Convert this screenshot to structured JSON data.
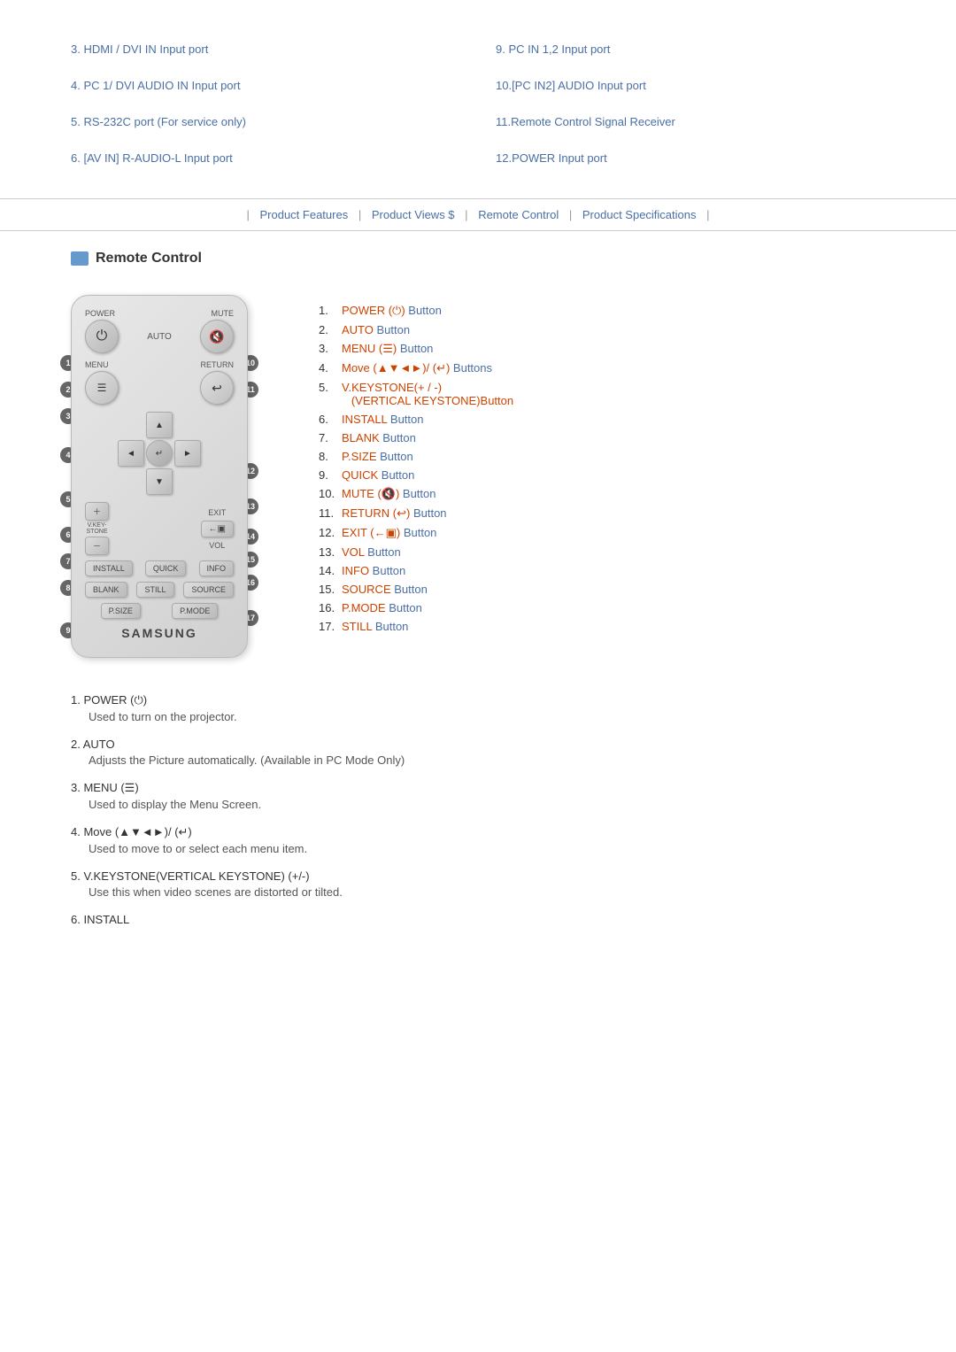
{
  "top_items": [
    {
      "id": "item3",
      "text": "3. HDMI / DVI IN Input port"
    },
    {
      "id": "item9",
      "text": "9. PC IN 1,2 Input port"
    },
    {
      "id": "item4",
      "text": "4. PC 1/ DVI  AUDIO IN Input port"
    },
    {
      "id": "item10",
      "text": "10.[PC IN2]  AUDIO Input port"
    },
    {
      "id": "item5",
      "text": "5. RS-232C port (For service only)"
    },
    {
      "id": "item11",
      "text": "11.Remote Control Signal Receiver"
    },
    {
      "id": "item6",
      "text": "6. [AV IN] R-AUDIO-L Input port"
    },
    {
      "id": "item12",
      "text": "12.POWER Input port"
    }
  ],
  "nav": {
    "pipe": "|",
    "links": [
      "Product Features",
      "Product Views $",
      "Remote Control",
      "Product Specifications"
    ]
  },
  "section": {
    "title": "Remote Control"
  },
  "button_list": [
    {
      "num": "1.",
      "text": "POWER (",
      "icon": "⏻",
      "suffix": ") Button"
    },
    {
      "num": "2.",
      "text": "AUTO Button",
      "icon": "",
      "suffix": ""
    },
    {
      "num": "3.",
      "text": "MENU (",
      "icon": "☰",
      "suffix": ") Button"
    },
    {
      "num": "4.",
      "text": "Move (▲▼◄►)/ (",
      "icon": "↵",
      "suffix": ") Buttons"
    },
    {
      "num": "5.",
      "text": "V.KEYSTONE(+ / -)\n(VERTICAL KEYSTONE)Button",
      "icon": "",
      "suffix": ""
    },
    {
      "num": "6.",
      "text": "INSTALL Button",
      "icon": "",
      "suffix": ""
    },
    {
      "num": "7.",
      "text": "BLANK Button",
      "icon": "",
      "suffix": ""
    },
    {
      "num": "8.",
      "text": "P.SIZE Button",
      "icon": "",
      "suffix": ""
    },
    {
      "num": "9.",
      "text": "QUICK Button",
      "icon": "",
      "suffix": ""
    },
    {
      "num": "10.",
      "text": "MUTE (",
      "icon": "🔇",
      "suffix": ") Button"
    },
    {
      "num": "11.",
      "text": "RETURN (",
      "icon": "↩",
      "suffix": ") Button"
    },
    {
      "num": "12.",
      "text": "EXIT (←",
      "icon": "▣",
      "suffix": ") Button"
    },
    {
      "num": "13.",
      "text": "VOL Button",
      "icon": "",
      "suffix": ""
    },
    {
      "num": "14.",
      "text": "INFO Button",
      "icon": "",
      "suffix": ""
    },
    {
      "num": "15.",
      "text": "SOURCE Button",
      "icon": "",
      "suffix": ""
    },
    {
      "num": "16.",
      "text": "P.MODE Button",
      "icon": "",
      "suffix": ""
    },
    {
      "num": "17.",
      "text": "STILL Button",
      "icon": "",
      "suffix": ""
    }
  ],
  "descriptions": [
    {
      "num": "1.",
      "title": "POWER (⏻)",
      "desc": "Used to turn on the projector."
    },
    {
      "num": "2.",
      "title": "AUTO",
      "desc": "Adjusts the Picture automatically. (Available in PC Mode Only)"
    },
    {
      "num": "3.",
      "title": "MENU (☰)",
      "desc": "Used to display the Menu Screen."
    },
    {
      "num": "4.",
      "title": "Move (▲▼◄►)/ (↵)",
      "desc": "Used to move to or select each menu item."
    },
    {
      "num": "5.",
      "title": "V.KEYSTONE(VERTICAL KEYSTONE) (+/-)",
      "desc": "Use this when video scenes are distorted or tilted."
    },
    {
      "num": "6.",
      "title": "INSTALL",
      "desc": ""
    }
  ],
  "brand": "SAMSUNG"
}
